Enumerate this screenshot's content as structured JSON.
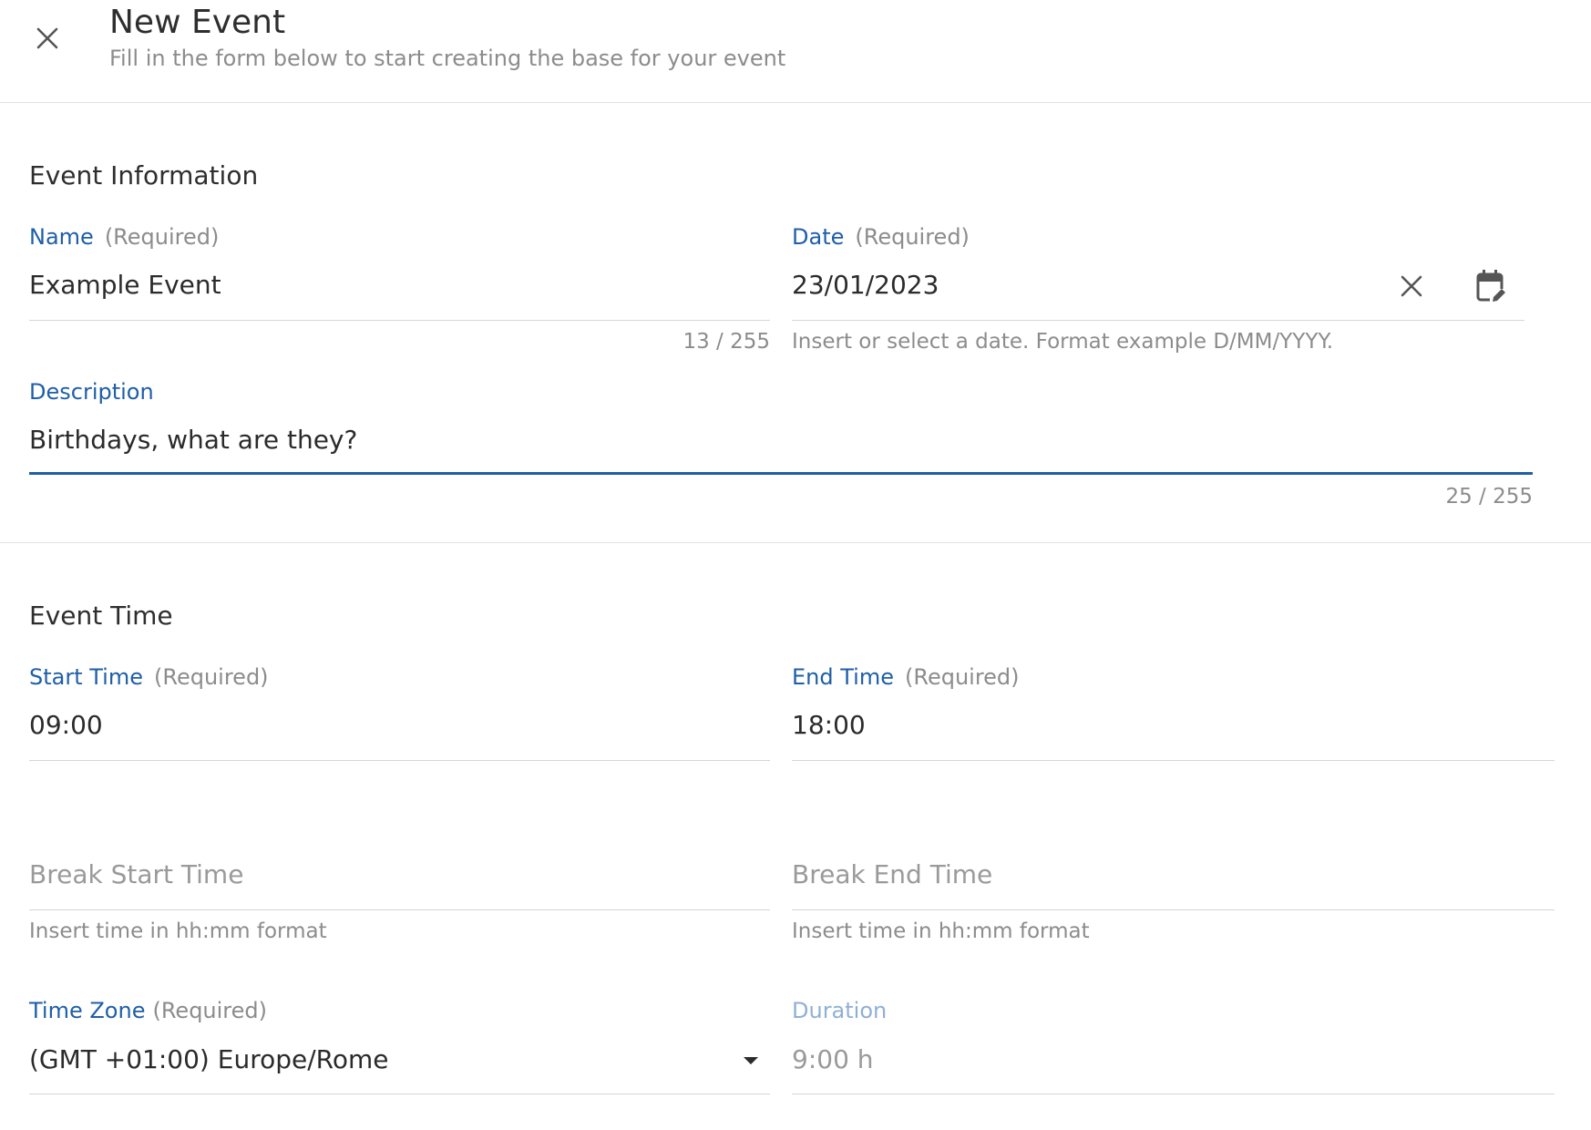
{
  "header": {
    "title": "New Event",
    "subtitle": "Fill in the form below to start creating the base for your event"
  },
  "event_information": {
    "title": "Event Information",
    "name": {
      "label": "Name",
      "required": "(Required)",
      "value": "Example Event",
      "counter": "13 / 255"
    },
    "date": {
      "label": "Date",
      "required": "(Required)",
      "value": "23/01/2023",
      "hint": "Insert or select a date. Format example D/MM/YYYY."
    },
    "description": {
      "label": "Description",
      "value": "Birthdays, what are they?",
      "counter": "25 / 255"
    }
  },
  "event_time": {
    "title": "Event Time",
    "start_time": {
      "label": "Start Time",
      "required": "(Required)",
      "value": "09:00"
    },
    "end_time": {
      "label": "End Time",
      "required": "(Required)",
      "value": "18:00"
    },
    "break_start": {
      "placeholder": "Break Start Time",
      "hint": "Insert time in hh:mm format"
    },
    "break_end": {
      "placeholder": "Break End Time",
      "hint": "Insert time in hh:mm format"
    },
    "time_zone": {
      "label": "Time Zone",
      "required": "(Required)",
      "value": "(GMT +01:00) Europe/Rome"
    },
    "duration": {
      "label": "Duration",
      "value": "9:00 h"
    }
  },
  "icons": {
    "close": "close-icon",
    "clear_date": "clear-icon",
    "calendar": "calendar-edit-icon",
    "dropdown": "caret-down-icon"
  },
  "colors": {
    "accent": "#1f5ea8",
    "accent_muted": "#8fb0d6",
    "text": "#2b2b2b",
    "muted_text": "#8c8c8c",
    "divider": "#e3e3e3"
  }
}
